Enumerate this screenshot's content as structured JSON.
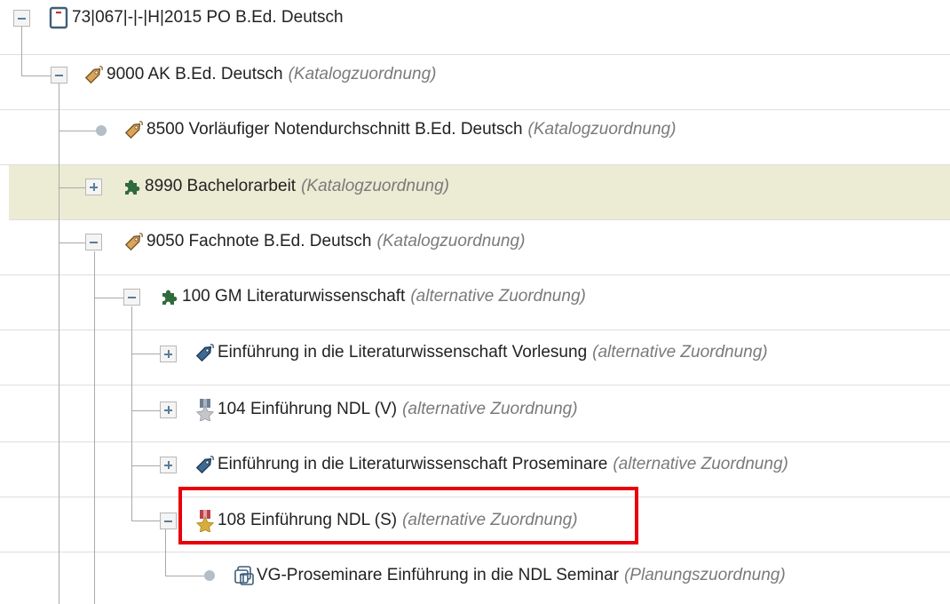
{
  "colors": {
    "highlight_row": "#ecebd4",
    "selection_border": "#e8000b",
    "meta_text": "#7a7a7a",
    "tree_line": "#a9a9a9"
  },
  "tree": {
    "nodes": [
      {
        "icon": "document-icon",
        "toggle": "collapse",
        "label": "73|067|-|-|H|2015 PO B.Ed. Deutsch",
        "meta": ""
      },
      {
        "icon": "tag-icon",
        "toggle": "collapse",
        "label": "9000 AK B.Ed. Deutsch",
        "meta": "(Katalogzuordnung)"
      },
      {
        "icon": "tag-icon",
        "toggle": "leaf",
        "label": "8500 Vorläufiger Notendurchschnitt B.Ed. Deutsch",
        "meta": "(Katalogzuordnung)"
      },
      {
        "icon": "puzzle-icon",
        "toggle": "expand",
        "label": "8990 Bachelorarbeit",
        "meta": "(Katalogzuordnung)",
        "highlighted": true
      },
      {
        "icon": "tag-icon",
        "toggle": "collapse",
        "label": "9050 Fachnote B.Ed. Deutsch",
        "meta": "(Katalogzuordnung)"
      },
      {
        "icon": "puzzle-icon",
        "toggle": "collapse",
        "label": "100 GM Literaturwissenschaft",
        "meta": "(alternative Zuordnung)"
      },
      {
        "icon": "tag-blue-icon",
        "toggle": "expand",
        "label": "Einführung in die Literaturwissenschaft Vorlesung",
        "meta": "(alternative Zuordnung)"
      },
      {
        "icon": "medal-silver-icon",
        "toggle": "expand",
        "label": "104 Einführung NDL (V)",
        "meta": "(alternative Zuordnung)"
      },
      {
        "icon": "tag-blue-icon",
        "toggle": "expand",
        "label": "Einführung in die Literaturwissenschaft Proseminare",
        "meta": "(alternative Zuordnung)"
      },
      {
        "icon": "medal-gold-icon",
        "toggle": "collapse",
        "label": "108 Einführung NDL (S)",
        "meta": "(alternative Zuordnung)",
        "selected": true
      },
      {
        "icon": "course-group-icon",
        "toggle": "leaf",
        "label": "VG-Proseminare Einführung in die NDL Seminar",
        "meta": "(Planungszuordnung)"
      }
    ]
  }
}
